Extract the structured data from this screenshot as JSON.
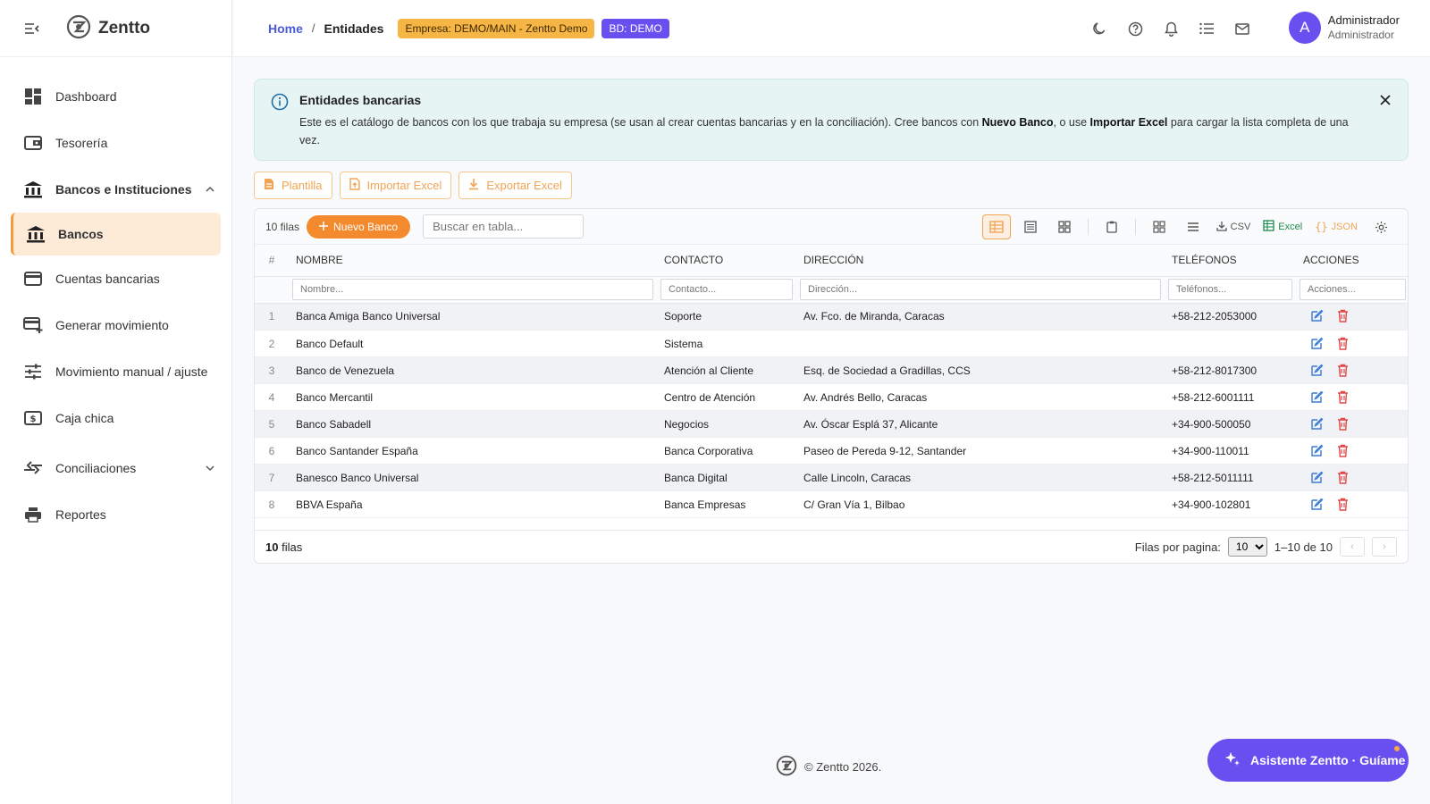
{
  "app": {
    "name": "Zentto"
  },
  "sidebar": {
    "items": [
      {
        "label": "Dashboard",
        "icon": "dashboard-icon"
      },
      {
        "label": "Tesorería",
        "icon": "wallet-icon"
      },
      {
        "label": "Bancos e Instituciones",
        "icon": "bank-icon",
        "group": true,
        "expanded": true
      },
      {
        "label": "Bancos",
        "icon": "bank-icon",
        "active": true
      },
      {
        "label": "Cuentas bancarias",
        "icon": "credit-card-icon"
      },
      {
        "label": "Generar movimiento",
        "icon": "card-add-icon"
      },
      {
        "label": "Movimiento manual / ajuste",
        "icon": "sliders-icon"
      },
      {
        "label": "Caja chica",
        "icon": "cash-icon"
      },
      {
        "label": "Conciliaciones",
        "icon": "compare-arrows-icon",
        "group": true,
        "expanded": false
      },
      {
        "label": "Reportes",
        "icon": "printer-icon"
      }
    ]
  },
  "header": {
    "breadcrumb_home": "Home",
    "breadcrumb_sep": "/",
    "breadcrumb_current": "Entidades",
    "badge_company": "Empresa: DEMO/MAIN - Zentto Demo",
    "badge_db": "BD: DEMO",
    "user_initial": "A",
    "user_name": "Administrador",
    "user_role": "Administrador"
  },
  "alert": {
    "title": "Entidades bancarias",
    "text_1": "Este es el catálogo de bancos con los que trabaja su empresa (se usan al crear cuentas bancarias y en la conciliación). Cree bancos con ",
    "bold_1": "Nuevo Banco",
    "text_2": ", o use ",
    "bold_2": "Importar Excel",
    "text_3": " para cargar la lista completa de una vez."
  },
  "actions": {
    "template_label": "Plantilla",
    "import_label": "Importar Excel",
    "export_label": "Exportar Excel"
  },
  "table": {
    "row_count_label": "10 filas",
    "new_button_label": "Nuevo Banco",
    "search_placeholder": "Buscar en tabla...",
    "tool_csv": "CSV",
    "tool_excel": "Excel",
    "tool_json": "JSON",
    "columns": [
      "#",
      "NOMBRE",
      "CONTACTO",
      "DIRECCIÓN",
      "TELÉFONOS",
      "ACCIONES"
    ],
    "filters": [
      "Nombre...",
      "Contacto...",
      "Dirección...",
      "Teléfonos...",
      "Acciones..."
    ],
    "rows": [
      {
        "n": "1",
        "nombre": "Banca Amiga Banco Universal",
        "contacto": "Soporte",
        "direccion": "Av. Fco. de Miranda, Caracas",
        "telefono": "+58-212-2053000"
      },
      {
        "n": "2",
        "nombre": "Banco Default",
        "contacto": "Sistema",
        "direccion": "",
        "telefono": ""
      },
      {
        "n": "3",
        "nombre": "Banco de Venezuela",
        "contacto": "Atención al Cliente",
        "direccion": "Esq. de Sociedad a Gradillas, CCS",
        "telefono": "+58-212-8017300"
      },
      {
        "n": "4",
        "nombre": "Banco Mercantil",
        "contacto": "Centro de Atención",
        "direccion": "Av. Andrés Bello, Caracas",
        "telefono": "+58-212-6001111"
      },
      {
        "n": "5",
        "nombre": "Banco Sabadell",
        "contacto": "Negocios",
        "direccion": "Av. Óscar Esplá 37, Alicante",
        "telefono": "+34-900-500050"
      },
      {
        "n": "6",
        "nombre": "Banco Santander España",
        "contacto": "Banca Corporativa",
        "direccion": "Paseo de Pereda 9-12, Santander",
        "telefono": "+34-900-110011"
      },
      {
        "n": "7",
        "nombre": "Banesco Banco Universal",
        "contacto": "Banca Digital",
        "direccion": "Calle Lincoln, Caracas",
        "telefono": "+58-212-5011111"
      },
      {
        "n": "8",
        "nombre": "BBVA España",
        "contacto": "Banca Empresas",
        "direccion": "C/ Gran Vía 1, Bilbao",
        "telefono": "+34-900-102801"
      }
    ],
    "footer_count": "10",
    "footer_count_label": "filas",
    "rows_per_page_label": "Filas por pagina:",
    "rows_per_page_value": "10",
    "range_label": "1–10 de 10"
  },
  "footer": {
    "copyright": "© Zentto 2026."
  },
  "assistant": {
    "label": "Asistente Zentto · Guíame"
  },
  "colors": {
    "accent": "#f38a2e",
    "purple": "#6a4ff0",
    "link": "#4b5ad6",
    "danger": "#e04848",
    "edit": "#3a7bd5"
  }
}
